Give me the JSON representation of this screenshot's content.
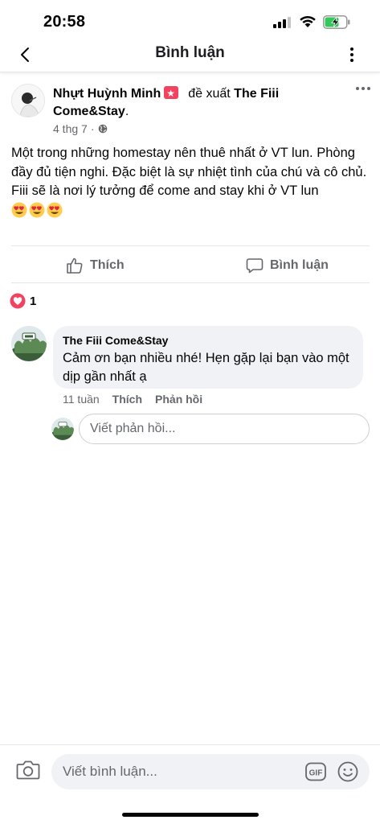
{
  "status": {
    "time": "20:58"
  },
  "nav": {
    "title": "Bình luận"
  },
  "post": {
    "author": "Nhựt Huỳnh Minh",
    "verb": "đề xuất",
    "page": "The Fiii Come&Stay",
    "punct": ".",
    "date": "4 thg 7",
    "separator": "·",
    "body": "Một trong những homestay nên thuê nhất ở VT lun. Phòng đầy đủ tiện nghi. Đặc biệt là sự nhiệt tình của chú và cô chủ. Fiii sẽ là nơi lý tưởng để come and stay khi ở VT lun",
    "emoji_count": 3
  },
  "actions": {
    "like": "Thích",
    "comment": "Bình luận"
  },
  "reactions": {
    "count": "1"
  },
  "comment": {
    "author": "The Fiii Come&Stay",
    "text": "Cảm ơn bạn nhiều nhé! Hẹn gặp lại bạn vào một dịp gần nhất ạ",
    "time": "11 tuần",
    "like": "Thích",
    "reply": "Phản hồi"
  },
  "reply_box": {
    "placeholder": "Viết phản hồi..."
  },
  "composer": {
    "placeholder": "Viết bình luận..."
  },
  "icons": {
    "back": "chevron-left-icon",
    "more": "more-vertical-icon",
    "post_more": "more-horizontal-icon",
    "badge": "recommend-icon",
    "audience": "globe-icon",
    "emoji": "heart-eyes-emoji-icon",
    "like": "thumbs-up-icon",
    "comment": "comment-bubble-icon",
    "reaction": "love-reaction-icon",
    "camera": "camera-icon",
    "gif": "gif-icon",
    "sticker": "smile-icon"
  },
  "colors": {
    "accent": "#1877f2",
    "love": "#f3425f",
    "muted": "#65676b",
    "bubble": "#f0f2f5"
  }
}
